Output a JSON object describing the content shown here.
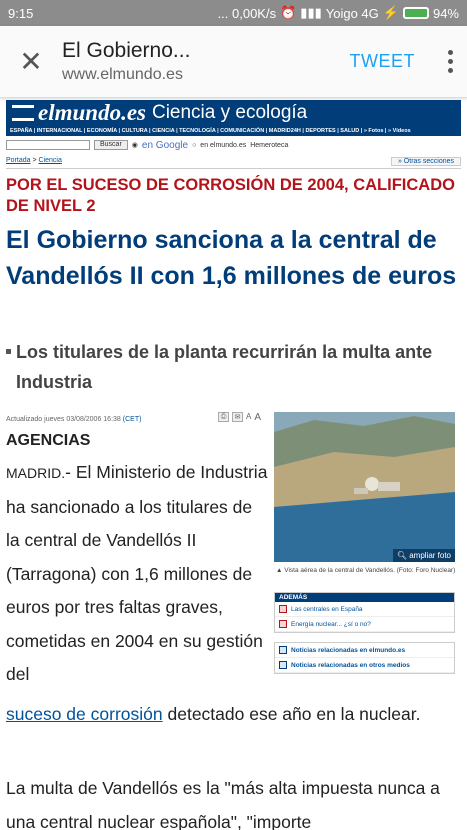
{
  "status_bar": {
    "time": "9:15",
    "net_speed": "... 0,00K/s",
    "carrier": "Yoigo 4G",
    "battery": "94%"
  },
  "app_bar": {
    "title": "El Gobierno...",
    "url": "www.elmundo.es",
    "tweet_label": "TWEET"
  },
  "site": {
    "logo": "elmundo.es",
    "section": "Ciencia y ecología",
    "nav": "ESPAÑA | INTERNACIONAL | ECONOMÍA | CULTURA | CIENCIA | TECNOLOGÍA | COMUNICACIÓN | MADRID24H | DEPORTES | SALUD | » Fotos | » Vídeos",
    "search_button": "Buscar",
    "search_google": "en Google",
    "search_elmundo": "en elmundo.es",
    "hemeroteca": "Hemeroteca",
    "breadcrumb_home": "Portada",
    "breadcrumb_sep": " > ",
    "breadcrumb_section": "Ciencia",
    "otras_secciones": "» Otras secciones"
  },
  "article": {
    "kicker": "POR EL SUCESO DE CORROSIÓN DE 2004, CALIFICADO DE NIVEL 2",
    "headline": "El Gobierno sanciona a la central de Vandellós II con 1,6 millones de euros",
    "subhead": "Los titulares de la planta recurrirán la multa ante Industria",
    "updated": "Actualizado jueves 03/08/2006 16:38",
    "updated_tz": "(CET)",
    "byline": "AGENCIAS",
    "dateline": "MADRID.",
    "body_p1_narrow": "- El Ministerio de Industria ha sancionado a los titulares de la central de Vandellós II (Tarragona) con 1,6 millones de euros por tres faltas graves, cometidas en 2004 en su gestión del",
    "body_p1_link": "suceso de corrosión",
    "body_p1_tail": " detectado ese año en la nuclear.",
    "body_p2": "La multa de Vandellós es la \"más alta impuesta nunca a una central nuclear española\", \"importe"
  },
  "sidebar": {
    "photo_button": "ampliar foto",
    "caption": "Vista aérea de la central de Vandellós. (Foto: Foro Nuclear)",
    "ademas_header": "ADEMÁS",
    "ademas_items": [
      "Las centrales en España",
      "Energía nuclear... ¿sí o no?"
    ],
    "related_items": [
      "Noticias relacionadas en elmundo.es",
      "Noticias relacionadas en otros medios"
    ]
  }
}
